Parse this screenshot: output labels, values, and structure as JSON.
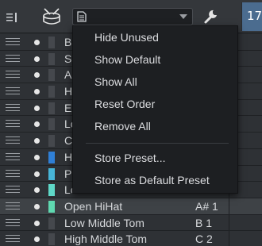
{
  "toolbar": {
    "left_icon": "instrument-list-icon",
    "drum_icon": "drum-icon",
    "preset_icon": "document-icon",
    "wrench_icon": "wrench-icon",
    "number_badge": "17"
  },
  "menu": {
    "items": [
      {
        "label": "Hide Unused"
      },
      {
        "label": "Show Default"
      },
      {
        "label": "Show All"
      },
      {
        "label": "Reset Order"
      },
      {
        "label": "Remove All"
      },
      {
        "label": "Store Preset..."
      },
      {
        "label": "Store as Default Preset"
      }
    ]
  },
  "rows": [
    {
      "name": "B",
      "key": "",
      "color": ""
    },
    {
      "name": "S",
      "key": "",
      "color": ""
    },
    {
      "name": "A",
      "key": "",
      "color": ""
    },
    {
      "name": "H",
      "key": "",
      "color": ""
    },
    {
      "name": "E",
      "key": "",
      "color": ""
    },
    {
      "name": "Lo",
      "key": "",
      "color": ""
    },
    {
      "name": "C",
      "key": "",
      "color": ""
    },
    {
      "name": "H",
      "key": "",
      "color": "#2f7fd6"
    },
    {
      "name": "P",
      "key": "",
      "color": "#48b5d8"
    },
    {
      "name": "Lo",
      "key": "",
      "color": "#5fd8c8"
    },
    {
      "name": "Open HiHat",
      "key": "A# 1",
      "color": "#5fd8b0"
    },
    {
      "name": "Low Middle Tom",
      "key": "B 1",
      "color": ""
    },
    {
      "name": "High Middle Tom",
      "key": "C 2",
      "color": ""
    }
  ]
}
